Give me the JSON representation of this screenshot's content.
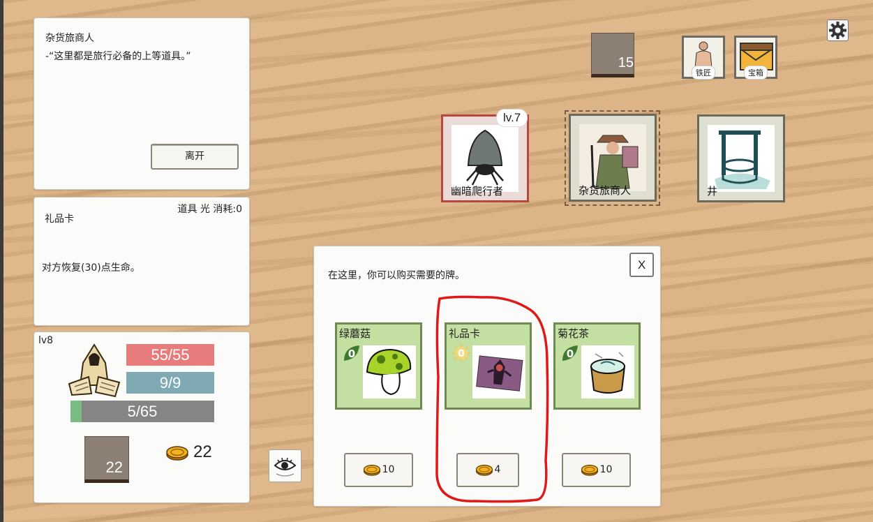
{
  "dialog": {
    "speaker": "杂货旅商人",
    "line": "-“这里都是旅行必备的上等道具。”",
    "leave_label": "离开"
  },
  "card_info": {
    "tags": "道具 光 消耗:0",
    "name": "礼品卡",
    "description": "对方恢复(30)点生命。"
  },
  "player": {
    "level": "lv8",
    "hp": "55/55",
    "mp": "9/9",
    "xp": "5/65",
    "xp_progress": 0.077,
    "deck_count": "22",
    "gold": "22"
  },
  "top_bar": {
    "deck_count": "15",
    "blacksmith_label": "铁匠",
    "chest_label": "宝箱"
  },
  "map_nodes": {
    "crawler": {
      "name": "幽暗爬行者",
      "level": "lv.7"
    },
    "merchant": {
      "name": "杂货旅商人"
    },
    "well": {
      "name": "井"
    }
  },
  "shop": {
    "hint": "在这里，你可以购买需要的牌。",
    "close_label": "X",
    "items": [
      {
        "name": "绿蘑菇",
        "cost": "0",
        "price": "10"
      },
      {
        "name": "礼品卡",
        "cost": "0",
        "price": "4"
      },
      {
        "name": "菊花茶",
        "cost": "0",
        "price": "10"
      }
    ]
  },
  "colors": {
    "hp_bar": "#e87c7c",
    "mp_bar": "#80aab3",
    "xp_bar": "#858585",
    "xp_fill": "#79bd84",
    "shop_card": "#c3e0a2",
    "highlight": "#e01818"
  },
  "icons": [
    "gear-icon",
    "eye-icon",
    "coin-icon",
    "blacksmith-icon",
    "chest-icon",
    "spider-mushroom-art",
    "merchant-art",
    "well-art",
    "mushroom-art",
    "giftcard-art",
    "tea-art",
    "hooded-mage-avatar"
  ]
}
